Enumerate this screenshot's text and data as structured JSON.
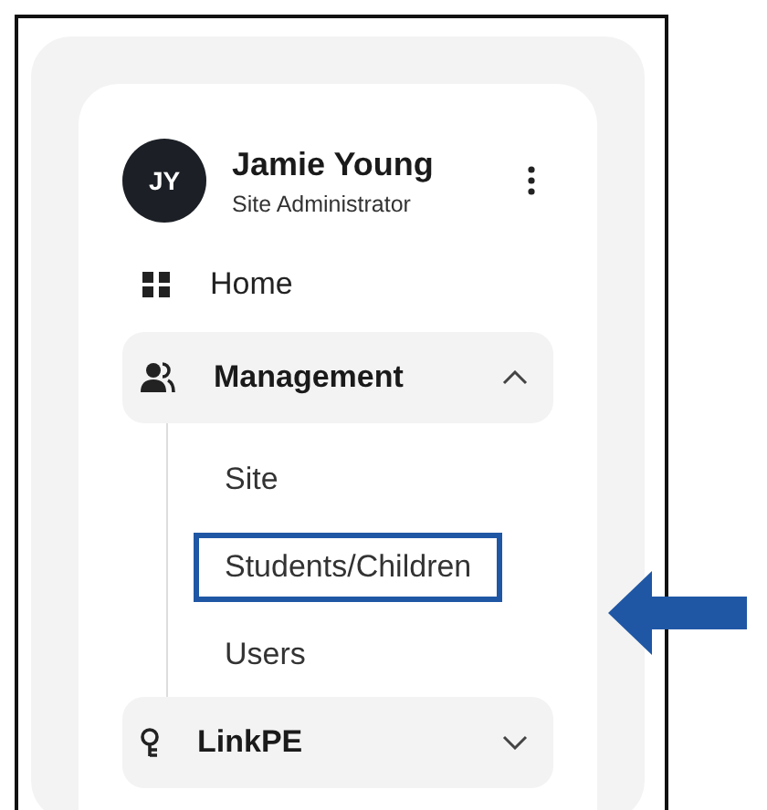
{
  "profile": {
    "initials": "JY",
    "name": "Jamie Young",
    "role": "Site Administrator"
  },
  "nav": [
    {
      "kind": "link",
      "label": "Home"
    },
    {
      "kind": "group",
      "label": "Management",
      "expanded": true,
      "children": [
        {
          "label": "Site",
          "highlighted": false
        },
        {
          "label": "Students/Children",
          "highlighted": true
        },
        {
          "label": "Users",
          "highlighted": false
        }
      ]
    },
    {
      "kind": "group",
      "label": "LinkPE",
      "expanded": false
    }
  ]
}
